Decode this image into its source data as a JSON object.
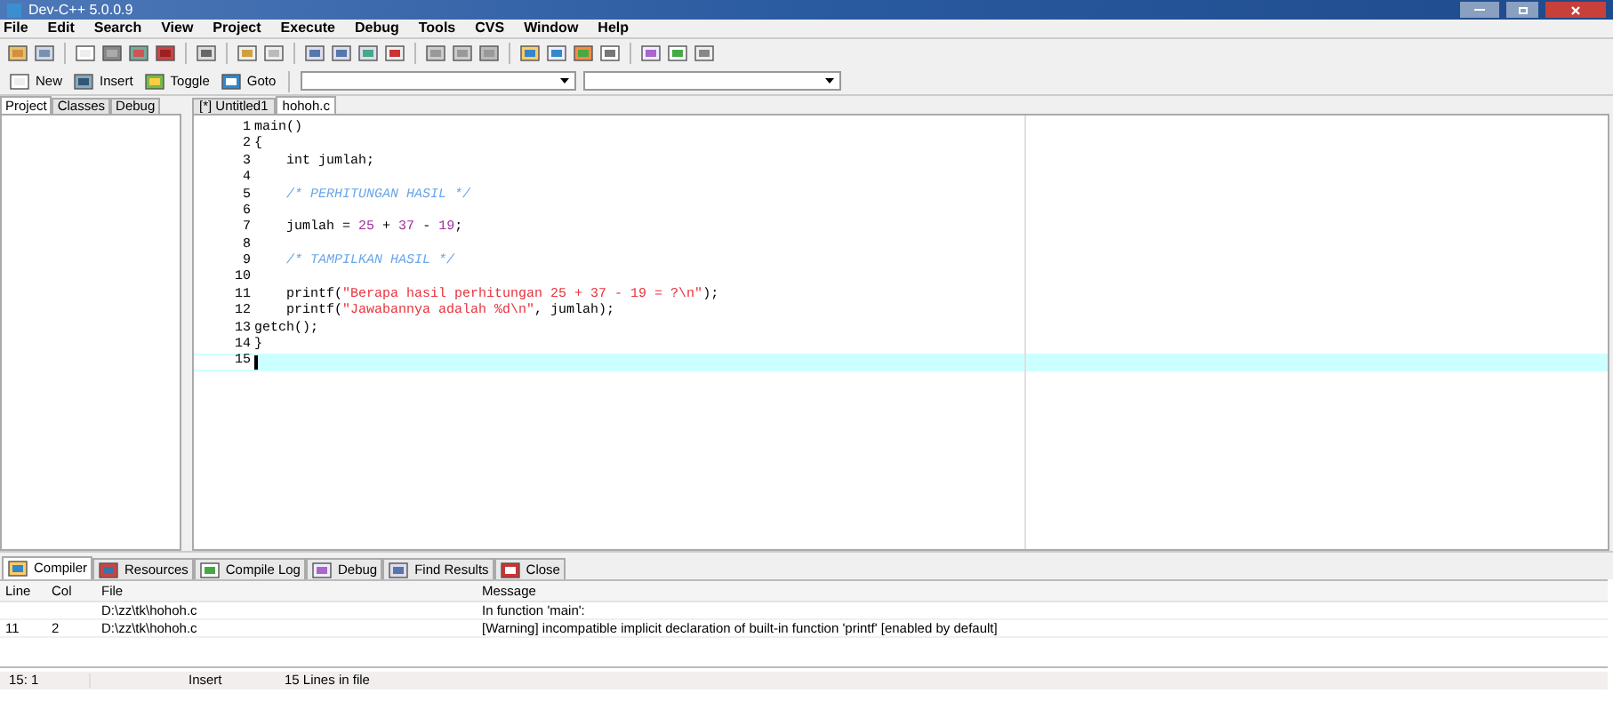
{
  "window": {
    "title": "Dev-C++ 5.0.0.9"
  },
  "menu": [
    "File",
    "Edit",
    "Search",
    "View",
    "Project",
    "Execute",
    "Debug",
    "Tools",
    "CVS",
    "Window",
    "Help"
  ],
  "toolbar2": {
    "buttons": [
      "New",
      "Insert",
      "Toggle",
      "Goto"
    ]
  },
  "left_tabs": [
    {
      "label": "Project",
      "selected": true
    },
    {
      "label": "Classes",
      "selected": false
    },
    {
      "label": "Debug",
      "selected": false
    }
  ],
  "editor_tabs": [
    {
      "label": "[*] Untitled1",
      "selected": false
    },
    {
      "label": "hohoh.c",
      "selected": true
    }
  ],
  "code_lines": [
    {
      "number": "1",
      "selected": false,
      "tokens": [
        {
          "kind": "plain",
          "text": "main()"
        }
      ]
    },
    {
      "number": "2",
      "selected": false,
      "tokens": [
        {
          "kind": "plain",
          "text": "{"
        }
      ]
    },
    {
      "number": "3",
      "selected": false,
      "tokens": [
        {
          "kind": "plain",
          "text": "    int jumlah;"
        }
      ]
    },
    {
      "number": "4",
      "selected": false
    },
    {
      "number": "5",
      "selected": false,
      "tokens": [
        {
          "kind": "comment",
          "text": "    /* PERHITUNGAN HASIL */"
        }
      ]
    },
    {
      "number": "6",
      "selected": false
    },
    {
      "number": "7",
      "selected": false,
      "tokens": [
        {
          "kind": "plain",
          "text": "    jumlah = "
        },
        {
          "kind": "number",
          "text": "25"
        },
        {
          "kind": "plain",
          "text": " + "
        },
        {
          "kind": "number",
          "text": "37"
        },
        {
          "kind": "plain",
          "text": " - "
        },
        {
          "kind": "number",
          "text": "19"
        },
        {
          "kind": "plain",
          "text": ";"
        }
      ]
    },
    {
      "number": "8",
      "selected": false
    },
    {
      "number": "9",
      "selected": false,
      "tokens": [
        {
          "kind": "comment",
          "text": "    /* TAMPILKAN HASIL */"
        }
      ]
    },
    {
      "number": "10",
      "selected": false
    },
    {
      "number": "11",
      "selected": false,
      "tokens": [
        {
          "kind": "plain",
          "text": "    printf("
        },
        {
          "kind": "string",
          "text": "\"Berapa hasil perhitungan 25 + 37 - 19 = ?\\n\""
        },
        {
          "kind": "plain",
          "text": ");"
        }
      ]
    },
    {
      "number": "12",
      "selected": false,
      "tokens": [
        {
          "kind": "plain",
          "text": "    printf("
        },
        {
          "kind": "string",
          "text": "\"Jawabannya adalah %d\\n\""
        },
        {
          "kind": "plain",
          "text": ", jumlah);"
        }
      ]
    },
    {
      "number": "13",
      "selected": false,
      "tokens": [
        {
          "kind": "plain",
          "text": "getch();"
        }
      ]
    },
    {
      "number": "14",
      "selected": false,
      "tokens": [
        {
          "kind": "plain",
          "text": "}"
        }
      ]
    },
    {
      "number": "15",
      "selected": true
    }
  ],
  "bottom_tabs": [
    {
      "label": "Compiler",
      "selected": true
    },
    {
      "label": "Resources",
      "selected": false
    },
    {
      "label": "Compile Log",
      "selected": false
    },
    {
      "label": "Debug",
      "selected": false
    },
    {
      "label": "Find Results",
      "selected": false
    },
    {
      "label": "Close",
      "selected": false
    }
  ],
  "compiler_table": {
    "columns": [
      "Line",
      "Col",
      "File",
      "Message"
    ],
    "rows": [
      {
        "line": "",
        "col": "",
        "file": "D:\\zz\\tk\\hohoh.c",
        "message": "In function 'main':"
      },
      {
        "line": "11",
        "col": "2",
        "file": "D:\\zz\\tk\\hohoh.c",
        "message": "[Warning] incompatible implicit declaration of built-in function 'printf' [enabled by default]"
      }
    ]
  },
  "status_bar": {
    "position": "15: 1",
    "mode": "Insert",
    "lines": "15 Lines in file"
  }
}
